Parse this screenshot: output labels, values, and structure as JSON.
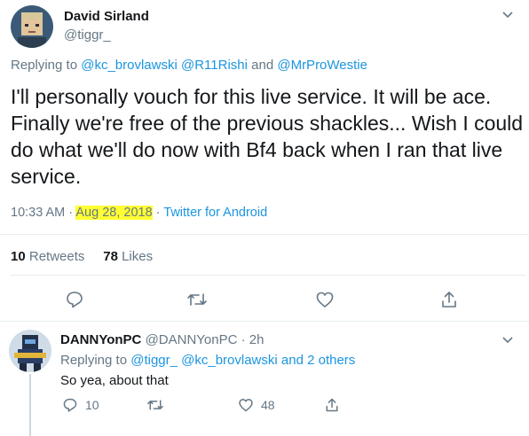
{
  "tweet": {
    "author_name": "David Sirland",
    "author_handle": "@tiggr_",
    "replying_prefix": "Replying to",
    "replying_mentions": [
      "@kc_brovlawski",
      "@R11Rishi",
      "and",
      "@MrProWestie"
    ],
    "text": "I'll personally vouch for this live service. It will be ace. Finally we're free of the previous shackles... Wish I could do what we'll do now with Bf4 back when I ran that live service.",
    "time": "10:33 AM",
    "date": "Aug 28, 2018",
    "source": "Twitter for Android",
    "retweets_count": "10",
    "retweets_label": "Retweets",
    "likes_count": "78",
    "likes_label": "Likes",
    "highlight_color": "#ffff33"
  },
  "reply": {
    "author_name": "DANNYonPC",
    "author_handle": "@DANNYonPC",
    "time_ago": "2h",
    "replying_prefix": "Replying to",
    "replying_mentions": "@tiggr_ @kc_brovlawski and 2 others",
    "text": "So yea, about that",
    "reply_count": "10",
    "like_count": "48"
  },
  "colors": {
    "link_blue": "#1b95e0",
    "secondary_gray": "#657786",
    "divider": "#e6ecf0"
  },
  "icons": [
    "chevron-down-icon",
    "reply-icon",
    "retweet-icon",
    "like-icon",
    "share-icon"
  ]
}
